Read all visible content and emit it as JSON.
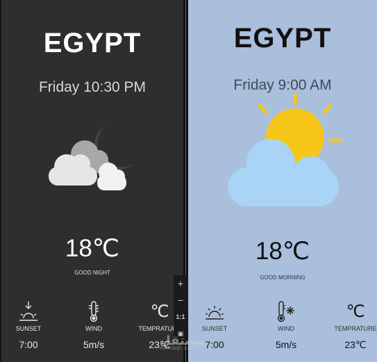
{
  "dark_card": {
    "country": "EGYPT",
    "datetime": "Friday 10:30 PM",
    "temperature": "18℃",
    "greeting": "GOOD NIGHT",
    "weather_icon": "cloudy-night-icon",
    "stats": [
      {
        "icon": "sunset-icon",
        "label": "SUNSET",
        "value": "7:00"
      },
      {
        "icon": "thermometer-icon",
        "label": "WIND",
        "value": "5m/s"
      },
      {
        "icon": "celsius-icon",
        "label": "TEMPRATURE",
        "value": "23℃"
      }
    ]
  },
  "light_card": {
    "country": "EGYPT",
    "datetime": "Friday 9:00 AM",
    "temperature": "18℃",
    "greeting": "GOOD MORNING",
    "weather_icon": "partly-sunny-icon",
    "stats": [
      {
        "icon": "sunset-icon",
        "label": "SUNSET",
        "value": "7:00"
      },
      {
        "icon": "thermometer-snow-icon",
        "label": "WIND",
        "value": "5m/s"
      },
      {
        "icon": "celsius-icon",
        "label": "TEMPRATURE",
        "value": "23℃"
      }
    ]
  },
  "zoom_tools": {
    "zoom_in": "+",
    "zoom_out": "−",
    "actual_size": "1:1",
    "fit": "▣"
  },
  "watermark": {
    "main": "مستقل",
    "sub": "mostaql.com"
  },
  "colors": {
    "dark_bg": "#2f2e2e",
    "light_bg": "#a9bfdc",
    "sun": "#f6c619",
    "cloud_light": "#a9d4f5"
  }
}
